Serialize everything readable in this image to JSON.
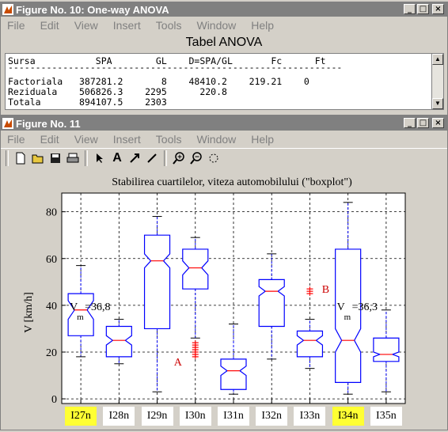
{
  "window1": {
    "title": "Figure No. 10: One-way ANOVA",
    "menu": [
      "File",
      "Edit",
      "View",
      "Insert",
      "Tools",
      "Window",
      "Help"
    ],
    "table_title": "Tabel ANOVA",
    "lines": [
      "Sursa           SPA        GL    D=SPA/GL       Fc      Ft",
      "-------------------------------------------------------------",
      "Factoriala   387281.2       8    48410.2    219.21    0",
      "Reziduala    506826.3    2295      220.8",
      "Totala       894107.5    2303"
    ]
  },
  "window2": {
    "title": "Figure No. 11",
    "menu": [
      "File",
      "Edit",
      "View",
      "Insert",
      "Tools",
      "Window",
      "Help"
    ]
  },
  "chart_data": {
    "type": "boxplot",
    "title": "Stabilirea cuartilelor, viteza automobilului (\"boxplot\")",
    "ylabel": "V [km/h]",
    "ylim": [
      -2,
      88
    ],
    "yticks": [
      0,
      20,
      40,
      60,
      80
    ],
    "grid": true,
    "categories": [
      "I27n",
      "I28n",
      "I29n",
      "I30n",
      "I31n",
      "I32n",
      "I33n",
      "I34n",
      "I35n"
    ],
    "highlighted": [
      "I27n",
      "I34n"
    ],
    "highlight_color": "#ffff33",
    "box_color": "#0000ff",
    "median_color": "#ff0000",
    "boxes": [
      {
        "wlo": 18,
        "q1": 27,
        "lnotch": 34,
        "med": 38,
        "unotch": 42,
        "q3": 45,
        "whi": 57,
        "outliers": []
      },
      {
        "wlo": 15,
        "q1": 18,
        "lnotch": 23,
        "med": 25,
        "unotch": 27,
        "q3": 31,
        "whi": 34,
        "outliers": []
      },
      {
        "wlo": 3,
        "q1": 30,
        "lnotch": 56,
        "med": 59,
        "unotch": 62,
        "q3": 70,
        "whi": 78,
        "outliers": []
      },
      {
        "wlo": 26,
        "q1": 47,
        "lnotch": 53,
        "med": 56,
        "unotch": 59,
        "q3": 64,
        "whi": 69,
        "outliers": [
          18,
          19,
          20,
          21,
          22,
          23,
          24
        ]
      },
      {
        "wlo": 2,
        "q1": 4,
        "lnotch": 10,
        "med": 12,
        "unotch": 14,
        "q3": 17,
        "whi": 32,
        "outliers": []
      },
      {
        "wlo": 17,
        "q1": 31,
        "lnotch": 44,
        "med": 46,
        "unotch": 48,
        "q3": 51,
        "whi": 62,
        "outliers": []
      },
      {
        "wlo": 13,
        "q1": 18,
        "lnotch": 23,
        "med": 25,
        "unotch": 27,
        "q3": 29,
        "whi": 34,
        "outliers": [
          45,
          46,
          47
        ]
      },
      {
        "wlo": 2,
        "q1": 7,
        "lnotch": 20,
        "med": 25,
        "unotch": 30,
        "q3": 64,
        "whi": 84,
        "outliers": []
      },
      {
        "wlo": 3,
        "q1": 16,
        "lnotch": 18,
        "med": 19,
        "unotch": 20,
        "q3": 26,
        "whi": 38,
        "outliers": []
      }
    ],
    "annotations": [
      {
        "text": "A",
        "series": "I30n",
        "y": 16,
        "color": "#cc0000"
      },
      {
        "text": "B",
        "series": "I33n",
        "y": 47,
        "color": "#cc0000"
      }
    ],
    "mean_labels": [
      {
        "series": "I27n",
        "V": "V",
        "sub": "m",
        "rest": "=36,8",
        "y": 38
      },
      {
        "series": "I34n",
        "V": "V",
        "sub": "m",
        "rest": "=36,3",
        "y": 38
      }
    ]
  }
}
